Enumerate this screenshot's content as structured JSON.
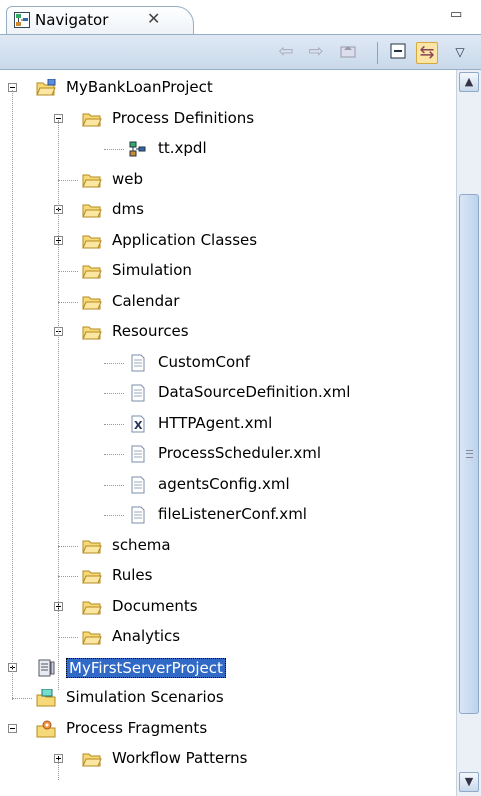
{
  "tab": {
    "title": "Navigator",
    "close_glyph": "✕",
    "minimize_glyph": "▭",
    "maximize_glyph": "□"
  },
  "toolbar": {
    "back_icon": "back-arrow-icon",
    "forward_icon": "forward-arrow-icon",
    "up_icon": "up-folder-icon",
    "collapse_icon": "collapse-all-icon",
    "link_icon": "link-with-editor-icon",
    "menu_icon": "view-menu-icon"
  },
  "tree": [
    {
      "label": "MyBankLoanProject",
      "icon": "project-folder",
      "depth": 0,
      "expander": "minus"
    },
    {
      "label": "Process Definitions",
      "icon": "folder",
      "depth": 1,
      "expander": "minus"
    },
    {
      "label": "tt.xpdl",
      "icon": "xpdl-file",
      "depth": 2,
      "expander": null
    },
    {
      "label": "web",
      "icon": "folder",
      "depth": 1,
      "expander": null
    },
    {
      "label": "dms",
      "icon": "folder",
      "depth": 1,
      "expander": "plus"
    },
    {
      "label": "Application Classes",
      "icon": "folder",
      "depth": 1,
      "expander": "plus"
    },
    {
      "label": "Simulation",
      "icon": "folder",
      "depth": 1,
      "expander": null
    },
    {
      "label": "Calendar",
      "icon": "folder",
      "depth": 1,
      "expander": null
    },
    {
      "label": "Resources",
      "icon": "folder",
      "depth": 1,
      "expander": "minus"
    },
    {
      "label": "CustomConf",
      "icon": "file",
      "depth": 2,
      "expander": null
    },
    {
      "label": "DataSourceDefinition.xml",
      "icon": "file",
      "depth": 2,
      "expander": null
    },
    {
      "label": "HTTPAgent.xml",
      "icon": "xml-x-file",
      "depth": 2,
      "expander": null
    },
    {
      "label": "ProcessScheduler.xml",
      "icon": "file",
      "depth": 2,
      "expander": null
    },
    {
      "label": "agentsConfig.xml",
      "icon": "file",
      "depth": 2,
      "expander": null
    },
    {
      "label": "fileListenerConf.xml",
      "icon": "file",
      "depth": 2,
      "expander": null
    },
    {
      "label": "schema",
      "icon": "folder",
      "depth": 1,
      "expander": null
    },
    {
      "label": "Rules",
      "icon": "folder",
      "depth": 1,
      "expander": null
    },
    {
      "label": "Documents",
      "icon": "folder",
      "depth": 1,
      "expander": "plus"
    },
    {
      "label": "Analytics",
      "icon": "folder",
      "depth": 1,
      "expander": null
    },
    {
      "label": "MyFirstServerProject",
      "icon": "server-project",
      "depth": 0,
      "expander": "plus",
      "selected": true
    },
    {
      "label": "Simulation Scenarios",
      "icon": "simulation-scenarios",
      "depth": 0,
      "expander": null
    },
    {
      "label": "Process Fragments",
      "icon": "process-fragments",
      "depth": 0,
      "expander": "minus"
    },
    {
      "label": "Workflow Patterns",
      "icon": "folder",
      "depth": 1,
      "expander": "plus"
    }
  ],
  "scrollbar": {
    "up_glyph": "▲",
    "down_glyph": "▼"
  },
  "colors": {
    "selection": "#3169c6",
    "folder": "#f2c94c",
    "toolbar": "#d3e0ee"
  }
}
